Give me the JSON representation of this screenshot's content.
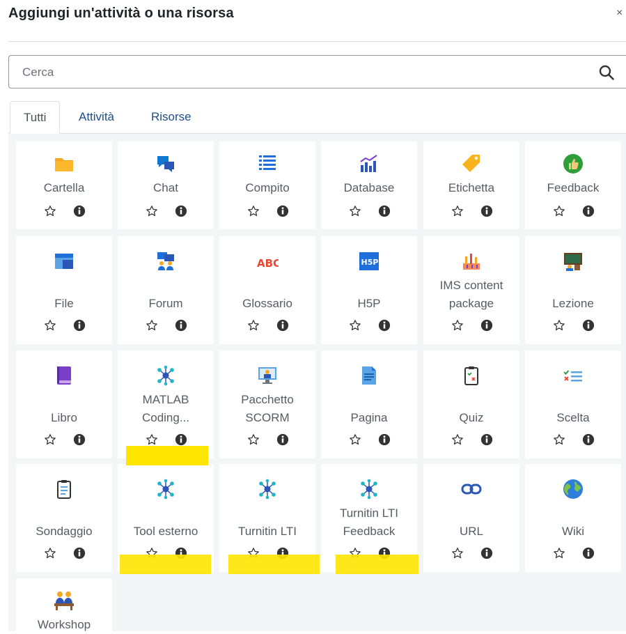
{
  "dialog": {
    "title": "Aggiungi un'attività o una risorsa",
    "close_label": "×"
  },
  "search": {
    "placeholder": "Cerca"
  },
  "tabs": [
    {
      "label": "Tutti"
    },
    {
      "label": "Attività"
    },
    {
      "label": "Risorse"
    }
  ],
  "items": [
    {
      "label": "Cartella"
    },
    {
      "label": "Chat"
    },
    {
      "label": "Compito"
    },
    {
      "label": "Database"
    },
    {
      "label": "Etichetta"
    },
    {
      "label": "Feedback"
    },
    {
      "label": "File"
    },
    {
      "label": "Forum"
    },
    {
      "label": "Glossario"
    },
    {
      "label": "H5P"
    },
    {
      "label": "IMS content package"
    },
    {
      "label": "Lezione"
    },
    {
      "label": "Libro"
    },
    {
      "label": "MATLAB Coding..."
    },
    {
      "label": "Pacchetto SCORM"
    },
    {
      "label": "Pagina"
    },
    {
      "label": "Quiz"
    },
    {
      "label": "Scelta"
    },
    {
      "label": "Sondaggio"
    },
    {
      "label": "Tool esterno"
    },
    {
      "label": "Turnitin LTI"
    },
    {
      "label": "Turnitin LTI Feedback"
    },
    {
      "label": "URL"
    },
    {
      "label": "Wiki"
    },
    {
      "label": "Workshop"
    }
  ],
  "icons": {
    "h5p_text": "H5P",
    "abc_text": "ABC"
  },
  "colors": {
    "link": "#1d4e89",
    "highlight": "#ffe600",
    "grid_bg": "#f4f5f7"
  }
}
